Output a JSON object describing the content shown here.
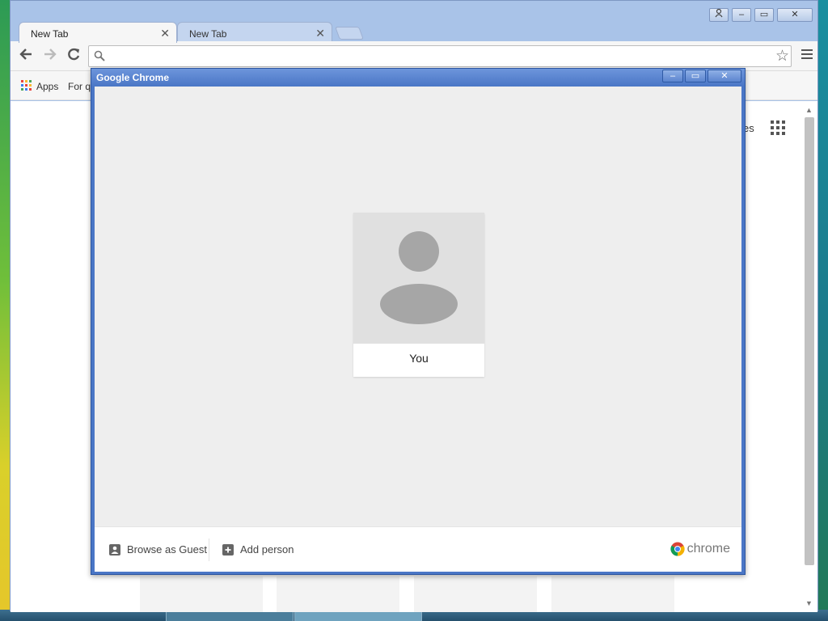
{
  "browser": {
    "tabs": [
      {
        "label": "New Tab",
        "active": true
      },
      {
        "label": "New Tab",
        "active": false
      }
    ],
    "window_controls": {
      "profile": "",
      "minimize": "–",
      "restore": "▭",
      "close": "✕"
    },
    "omnibox": {
      "value": "",
      "placeholder": ""
    },
    "bookmarks": [
      {
        "label": "Apps"
      },
      {
        "label": "For q"
      }
    ],
    "page_partial_text": "es"
  },
  "dialog": {
    "title": "Google Chrome",
    "controls": {
      "minimize": "–",
      "restore": "▭",
      "close": "✕"
    },
    "profile": {
      "name": "You"
    },
    "footer": {
      "guest_label": "Browse as Guest",
      "add_person_label": "Add person",
      "brand": "chrome"
    }
  },
  "colors": {
    "dialog_frame": "#4a76c6",
    "tab_strip": "#a9c3e8",
    "dialog_body": "#eeeeee",
    "avatar_bg": "#e0e0e0",
    "avatar_fg": "#a6a6a6"
  },
  "icons": [
    "back-arrow-icon",
    "forward-arrow-icon",
    "reload-icon",
    "search-icon",
    "star-icon",
    "menu-icon",
    "apps-grid-icon",
    "guest-icon",
    "add-person-icon",
    "chrome-logo-icon"
  ]
}
